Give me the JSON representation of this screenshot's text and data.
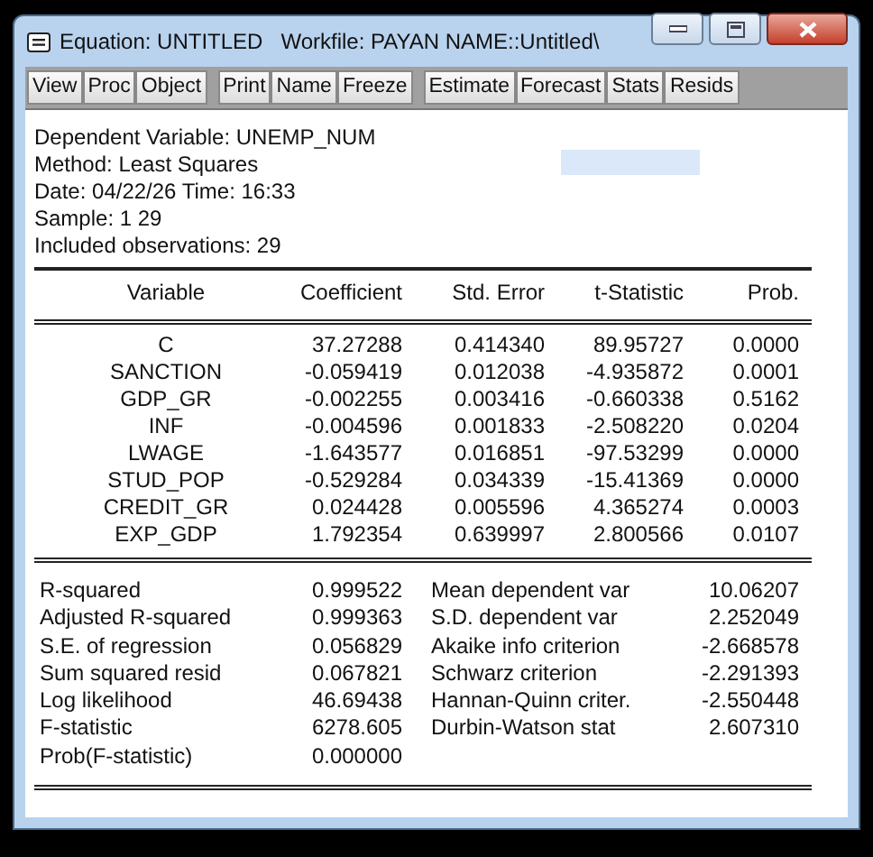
{
  "window": {
    "title": "Equation: UNTITLED   Workfile: PAYAN NAME::Untitled\\"
  },
  "toolbar_groups": [
    [
      "View",
      "Proc",
      "Object"
    ],
    [
      "Print",
      "Name",
      "Freeze"
    ],
    [
      "Estimate",
      "Forecast",
      "Stats",
      "Resids"
    ]
  ],
  "header_lines": [
    "Dependent Variable: UNEMP_NUM",
    "Method: Least Squares",
    "Date: 04/22/26   Time: 16:33",
    "Sample: 1 29",
    "Included observations: 29"
  ],
  "table": {
    "columns": [
      "Variable",
      "Coefficient",
      "Std. Error",
      "t-Statistic",
      "Prob."
    ],
    "rows": [
      [
        "C",
        "37.27288",
        "0.414340",
        "89.95727",
        "0.0000"
      ],
      [
        "SANCTION",
        "-0.059419",
        "0.012038",
        "-4.935872",
        "0.0001"
      ],
      [
        "GDP_GR",
        "-0.002255",
        "0.003416",
        "-0.660338",
        "0.5162"
      ],
      [
        "INF",
        "-0.004596",
        "0.001833",
        "-2.508220",
        "0.0204"
      ],
      [
        "LWAGE",
        "-1.643577",
        "0.016851",
        "-97.53299",
        "0.0000"
      ],
      [
        "STUD_POP",
        "-0.529284",
        "0.034339",
        "-15.41369",
        "0.0000"
      ],
      [
        "CREDIT_GR",
        "0.024428",
        "0.005596",
        "4.365274",
        "0.0003"
      ],
      [
        "EXP_GDP",
        "1.792354",
        "0.639997",
        "2.800566",
        "0.0107"
      ]
    ]
  },
  "statistics": [
    [
      "R-squared",
      "0.999522",
      "Mean dependent var",
      "10.06207"
    ],
    [
      "Adjusted R-squared",
      "0.999363",
      "S.D. dependent var",
      "2.252049"
    ],
    [
      "S.E. of regression",
      "0.056829",
      "Akaike info criterion",
      "-2.668578"
    ],
    [
      "Sum squared resid",
      "0.067821",
      "Schwarz criterion",
      "-2.291393"
    ],
    [
      "Log likelihood",
      "46.69438",
      "Hannan-Quinn criter.",
      "-2.550448"
    ],
    [
      "F-statistic",
      "6278.605",
      "Durbin-Watson stat",
      "2.607310"
    ],
    [
      "Prob(F-statistic)",
      "0.000000"
    ]
  ]
}
